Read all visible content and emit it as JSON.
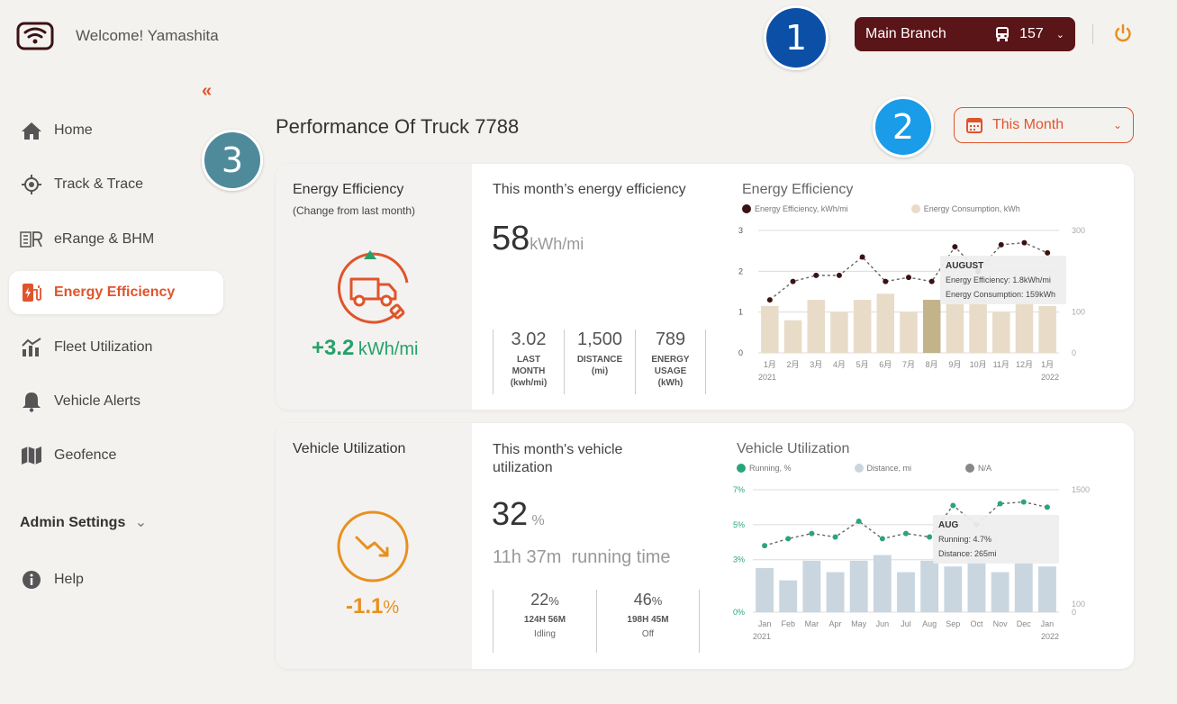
{
  "header": {
    "welcome": "Welcome! Yamashita",
    "branch": "Main Branch",
    "vehicle_count": "157"
  },
  "badges": [
    "1",
    "2",
    "3"
  ],
  "sidebar": {
    "items": [
      {
        "label": "Home",
        "icon": "home-icon"
      },
      {
        "label": "Track & Trace",
        "icon": "target-icon"
      },
      {
        "label": "eRange & BHM",
        "icon": "erange-icon"
      },
      {
        "label": "Energy Efficiency",
        "icon": "energy-charger-icon",
        "active": true
      },
      {
        "label": "Fleet Utilization",
        "icon": "bar-chart-icon"
      },
      {
        "label": "Vehicle Alerts",
        "icon": "bell-icon"
      },
      {
        "label": "Geofence",
        "icon": "map-icon"
      }
    ],
    "admin": "Admin Settings",
    "help": "Help"
  },
  "page": {
    "title": "Performance Of Truck 7788",
    "period": "This Month"
  },
  "energy": {
    "title": "Energy Efficiency",
    "subtitle": "(Change from last month)",
    "change": "+3.2",
    "change_unit": "kWh/mi",
    "month_title": "This month’s energy efficiency",
    "value": "58",
    "unit": "kWh/mi",
    "stats": [
      {
        "value": "3.02",
        "label1": "LAST",
        "label2": "MONTH",
        "label3": "(kwh/mi)"
      },
      {
        "value": "1,500",
        "label1": "DISTANCE",
        "label2": "(mi)",
        "label3": ""
      },
      {
        "value": "789",
        "label1": "ENERGY",
        "label2": "USAGE",
        "label3": "(kWh)"
      }
    ]
  },
  "utilization": {
    "title": "Vehicle Utilization",
    "month_title_1": "This month's vehicle",
    "month_title_2": "utilization",
    "value": "32",
    "unit": "%",
    "change": "-1.1",
    "change_unit": "%",
    "running_time": "11h 37m",
    "running_label": "running time",
    "stats": [
      {
        "value": "22",
        "unit": "%",
        "time": "124H 56M",
        "label": "Idling"
      },
      {
        "value": "46",
        "unit": "%",
        "time": "198H 45M",
        "label": "Off"
      }
    ]
  },
  "chart_data": [
    {
      "type": "bar",
      "title": "Energy Efficiency",
      "categories": [
        "1月",
        "2月",
        "3月",
        "4月",
        "5月",
        "6月",
        "7月",
        "8月",
        "9月",
        "10月",
        "11月",
        "12月",
        "1月"
      ],
      "x_years": [
        "2021",
        "2022"
      ],
      "series": [
        {
          "name": "Energy Efficiency, kWh/mi",
          "kind": "line",
          "axis": "left",
          "values": [
            1.3,
            1.75,
            1.9,
            1.9,
            2.35,
            1.75,
            1.85,
            1.75,
            2.6,
            2.0,
            2.65,
            2.7,
            2.45
          ]
        },
        {
          "name": "Energy Consumption, kWh",
          "kind": "bar",
          "axis": "right",
          "values": [
            115,
            80,
            130,
            100,
            130,
            145,
            100,
            130,
            135,
            140,
            100,
            125,
            115
          ]
        }
      ],
      "ylim_left": [
        0,
        3
      ],
      "ylim_right": [
        0,
        300
      ],
      "yticks_left": [
        "0",
        "1",
        "2",
        "3"
      ],
      "yticks_right": [
        "0",
        "100",
        "300"
      ],
      "highlight_index": 7,
      "tooltip": {
        "title": "AUGUST",
        "line1": "Energy Efficiency: 1.8kWh/mi",
        "line2": "Energy Consumption: 159kWh"
      },
      "colors": {
        "line": "#3b1214",
        "bar": "#e8dcc8",
        "highlight": "#c2b388"
      }
    },
    {
      "type": "bar",
      "title": "Vehicle Utilization",
      "categories": [
        "Jan",
        "Feb",
        "Mar",
        "Apr",
        "May",
        "Jun",
        "Jul",
        "Aug",
        "Sep",
        "Oct",
        "Nov",
        "Dec",
        "Jan"
      ],
      "x_years": [
        "2021",
        "2022"
      ],
      "series": [
        {
          "name": "Running, %",
          "kind": "line",
          "axis": "left",
          "values": [
            3.8,
            4.2,
            4.5,
            4.3,
            5.2,
            4.2,
            4.5,
            4.3,
            6.1,
            5.0,
            6.2,
            6.3,
            6.0
          ]
        },
        {
          "name": "Distance, mi",
          "kind": "bar",
          "axis": "right",
          "values": [
            540,
            390,
            630,
            490,
            630,
            700,
            490,
            630,
            560,
            650,
            490,
            610,
            560
          ]
        },
        {
          "name": "N/A",
          "kind": "legend-only",
          "values": []
        }
      ],
      "ylim_left": [
        0,
        7
      ],
      "ylim_right": [
        0,
        1500
      ],
      "yticks_left": [
        "0%",
        "3%",
        "5%",
        "7%"
      ],
      "yticks_right": [
        "0",
        "100",
        "1500"
      ],
      "tooltip": {
        "title": "AUG",
        "line1": "Running: 4.7%",
        "line2": "Distance: 265mi"
      },
      "colors": {
        "line": "#2aa57a",
        "bar": "#c9d6e0",
        "na": "#888888"
      }
    }
  ],
  "colors": {
    "accent": "#e0542c",
    "branch_bg": "#5a1519",
    "positive": "#27a06a",
    "negative": "#e8901e"
  }
}
